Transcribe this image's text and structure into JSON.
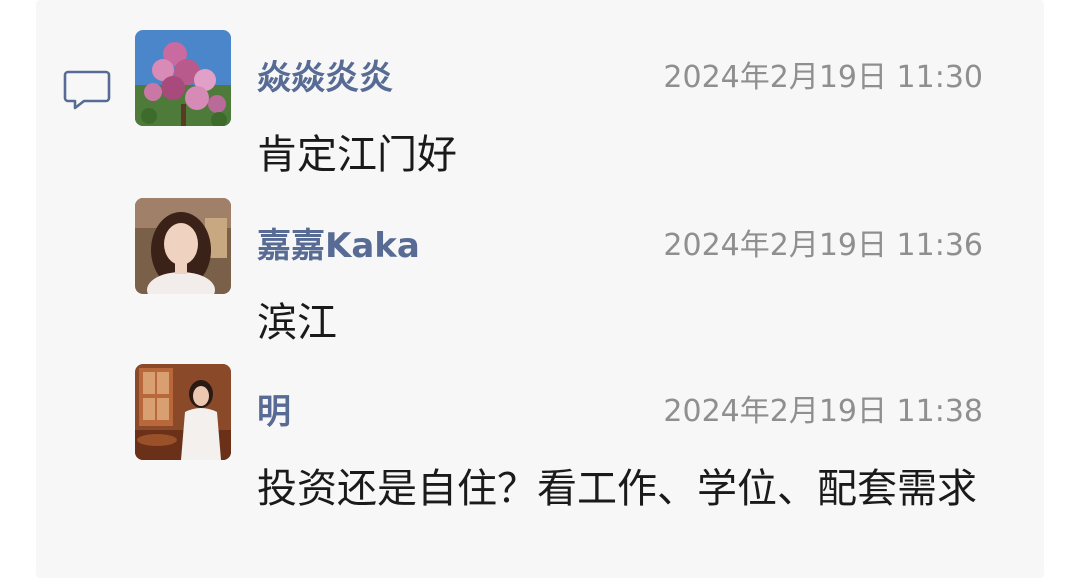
{
  "comments": [
    {
      "author": "焱焱炎炎",
      "time": "2024年2月19日 11:30",
      "text": "肯定江门好",
      "avatar": "flower-bush-avatar"
    },
    {
      "author": "嘉嘉Kaka",
      "time": "2024年2月19日 11:36",
      "text": "滨江",
      "avatar": "woman-portrait-avatar"
    },
    {
      "author": "明",
      "time": "2024年2月19日 11:38",
      "text": "投资还是自住？看工作、学位、配套需求",
      "avatar": "woman-seated-avatar"
    }
  ],
  "colors": {
    "author": "#576b95",
    "time": "#8f8f8f",
    "text": "#1a1a1a",
    "panel": "#f7f7f7"
  },
  "icons": {
    "comment": "comment-bubble-icon"
  }
}
